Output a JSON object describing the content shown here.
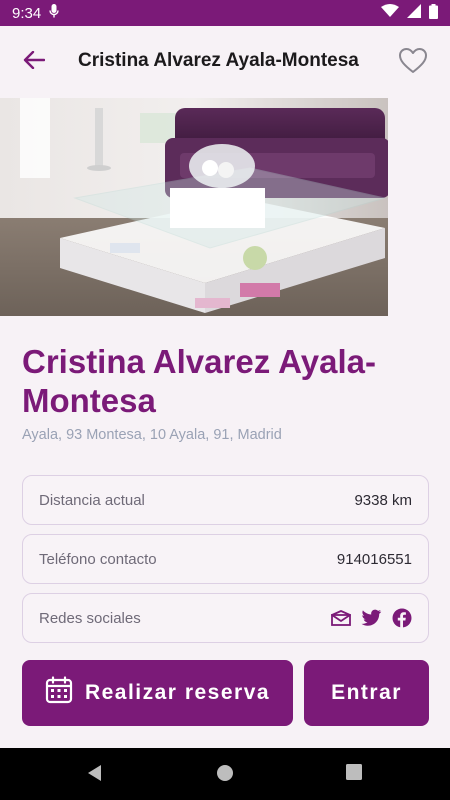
{
  "status_bar": {
    "time": "9:34"
  },
  "app_bar": {
    "title": "Cristina Alvarez Ayala-Montesa"
  },
  "hero": {
    "image": "salon-interior-photo"
  },
  "place": {
    "name": "Cristina Alvarez Ayala-Montesa",
    "address": "Ayala, 93 Montesa, 10 Ayala, 91, Madrid"
  },
  "info": {
    "distance": {
      "label": "Distancia actual",
      "value": "9338 km"
    },
    "phone": {
      "label": "Teléfono contacto",
      "value": "914016551"
    },
    "social": {
      "label": "Redes sociales",
      "icons": [
        "email-icon",
        "twitter-icon",
        "facebook-icon"
      ]
    }
  },
  "actions": {
    "reserve_label": "Realizar reserva",
    "enter_label": "Entrar"
  },
  "colors": {
    "primary": "#7b1a78",
    "background": "#f7f2f6",
    "muted": "#9aa2b5",
    "card_border": "#ddd0e4"
  }
}
